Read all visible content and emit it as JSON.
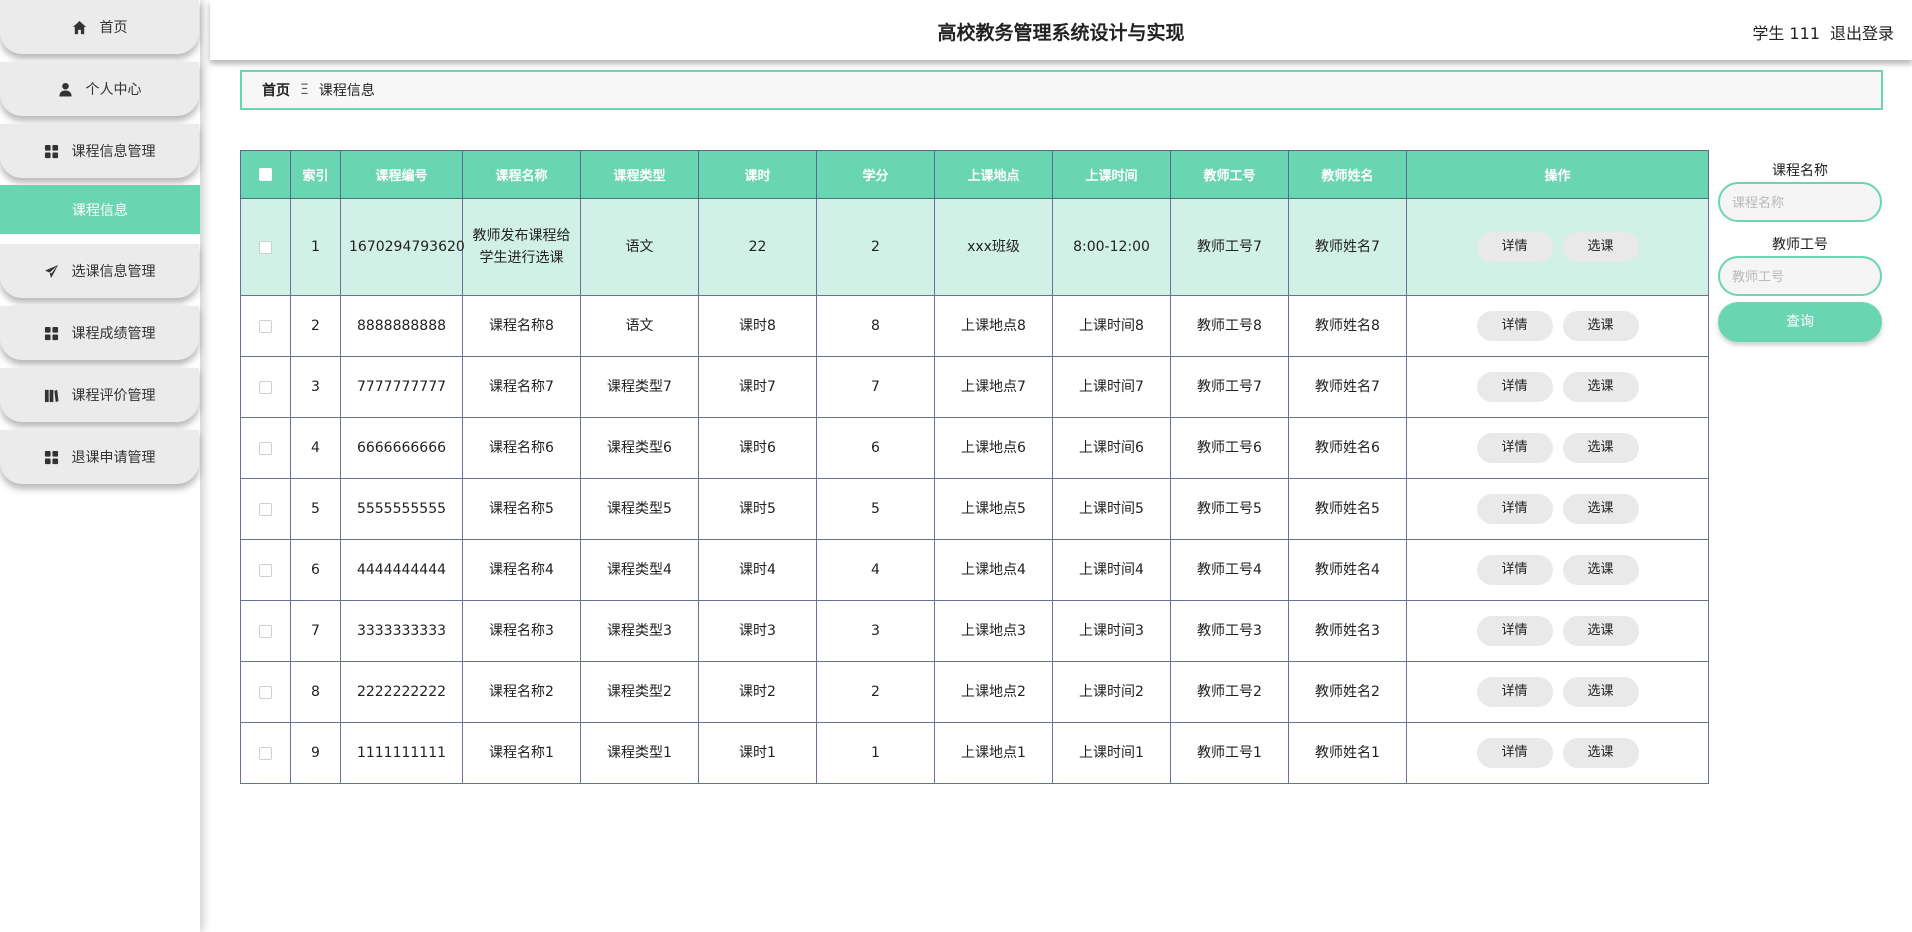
{
  "header": {
    "title": "高校教务管理系统设计与实现",
    "user": "学生 111",
    "logout": "退出登录"
  },
  "sidebar": {
    "items": [
      {
        "label": "首页",
        "icon": "home-icon"
      },
      {
        "label": "个人中心",
        "icon": "user-icon"
      },
      {
        "label": "课程信息管理",
        "icon": "grid-icon"
      },
      {
        "label": "课程信息"
      },
      {
        "label": "选课信息管理",
        "icon": "send-icon"
      },
      {
        "label": "课程成绩管理",
        "icon": "grid-icon"
      },
      {
        "label": "课程评价管理",
        "icon": "book-icon"
      },
      {
        "label": "退课申请管理",
        "icon": "grid-icon"
      }
    ]
  },
  "breadcrumb": {
    "home": "首页",
    "sep": "Ξ",
    "current": "课程信息"
  },
  "table": {
    "headers": [
      "索引",
      "课程编号",
      "课程名称",
      "课程类型",
      "课时",
      "学分",
      "上课地点",
      "上课时间",
      "教师工号",
      "教师姓名",
      "操作"
    ],
    "detail_label": "详情",
    "select_label": "选课",
    "rows": [
      {
        "idx": "1",
        "code": "1670294793620",
        "name": "教师发布课程给学生进行选课",
        "type": "语文",
        "hours": "22",
        "credit": "2",
        "place": "xxx班级",
        "time": "8:00-12:00",
        "tno": "教师工号7",
        "tname": "教师姓名7"
      },
      {
        "idx": "2",
        "code": "8888888888",
        "name": "课程名称8",
        "type": "语文",
        "hours": "课时8",
        "credit": "8",
        "place": "上课地点8",
        "time": "上课时间8",
        "tno": "教师工号8",
        "tname": "教师姓名8"
      },
      {
        "idx": "3",
        "code": "7777777777",
        "name": "课程名称7",
        "type": "课程类型7",
        "hours": "课时7",
        "credit": "7",
        "place": "上课地点7",
        "time": "上课时间7",
        "tno": "教师工号7",
        "tname": "教师姓名7"
      },
      {
        "idx": "4",
        "code": "6666666666",
        "name": "课程名称6",
        "type": "课程类型6",
        "hours": "课时6",
        "credit": "6",
        "place": "上课地点6",
        "time": "上课时间6",
        "tno": "教师工号6",
        "tname": "教师姓名6"
      },
      {
        "idx": "5",
        "code": "5555555555",
        "name": "课程名称5",
        "type": "课程类型5",
        "hours": "课时5",
        "credit": "5",
        "place": "上课地点5",
        "time": "上课时间5",
        "tno": "教师工号5",
        "tname": "教师姓名5"
      },
      {
        "idx": "6",
        "code": "4444444444",
        "name": "课程名称4",
        "type": "课程类型4",
        "hours": "课时4",
        "credit": "4",
        "place": "上课地点4",
        "time": "上课时间4",
        "tno": "教师工号4",
        "tname": "教师姓名4"
      },
      {
        "idx": "7",
        "code": "3333333333",
        "name": "课程名称3",
        "type": "课程类型3",
        "hours": "课时3",
        "credit": "3",
        "place": "上课地点3",
        "time": "上课时间3",
        "tno": "教师工号3",
        "tname": "教师姓名3"
      },
      {
        "idx": "8",
        "code": "2222222222",
        "name": "课程名称2",
        "type": "课程类型2",
        "hours": "课时2",
        "credit": "2",
        "place": "上课地点2",
        "time": "上课时间2",
        "tno": "教师工号2",
        "tname": "教师姓名2"
      },
      {
        "idx": "9",
        "code": "1111111111",
        "name": "课程名称1",
        "type": "课程类型1",
        "hours": "课时1",
        "credit": "1",
        "place": "上课地点1",
        "time": "上课时间1",
        "tno": "教师工号1",
        "tname": "教师姓名1"
      }
    ]
  },
  "search": {
    "course_label": "课程名称",
    "course_placeholder": "课程名称",
    "teacher_label": "教师工号",
    "teacher_placeholder": "教师工号",
    "query_label": "查询"
  },
  "colors": {
    "accent": "#6ad5b1",
    "selected_row": "#d1f1e7"
  }
}
